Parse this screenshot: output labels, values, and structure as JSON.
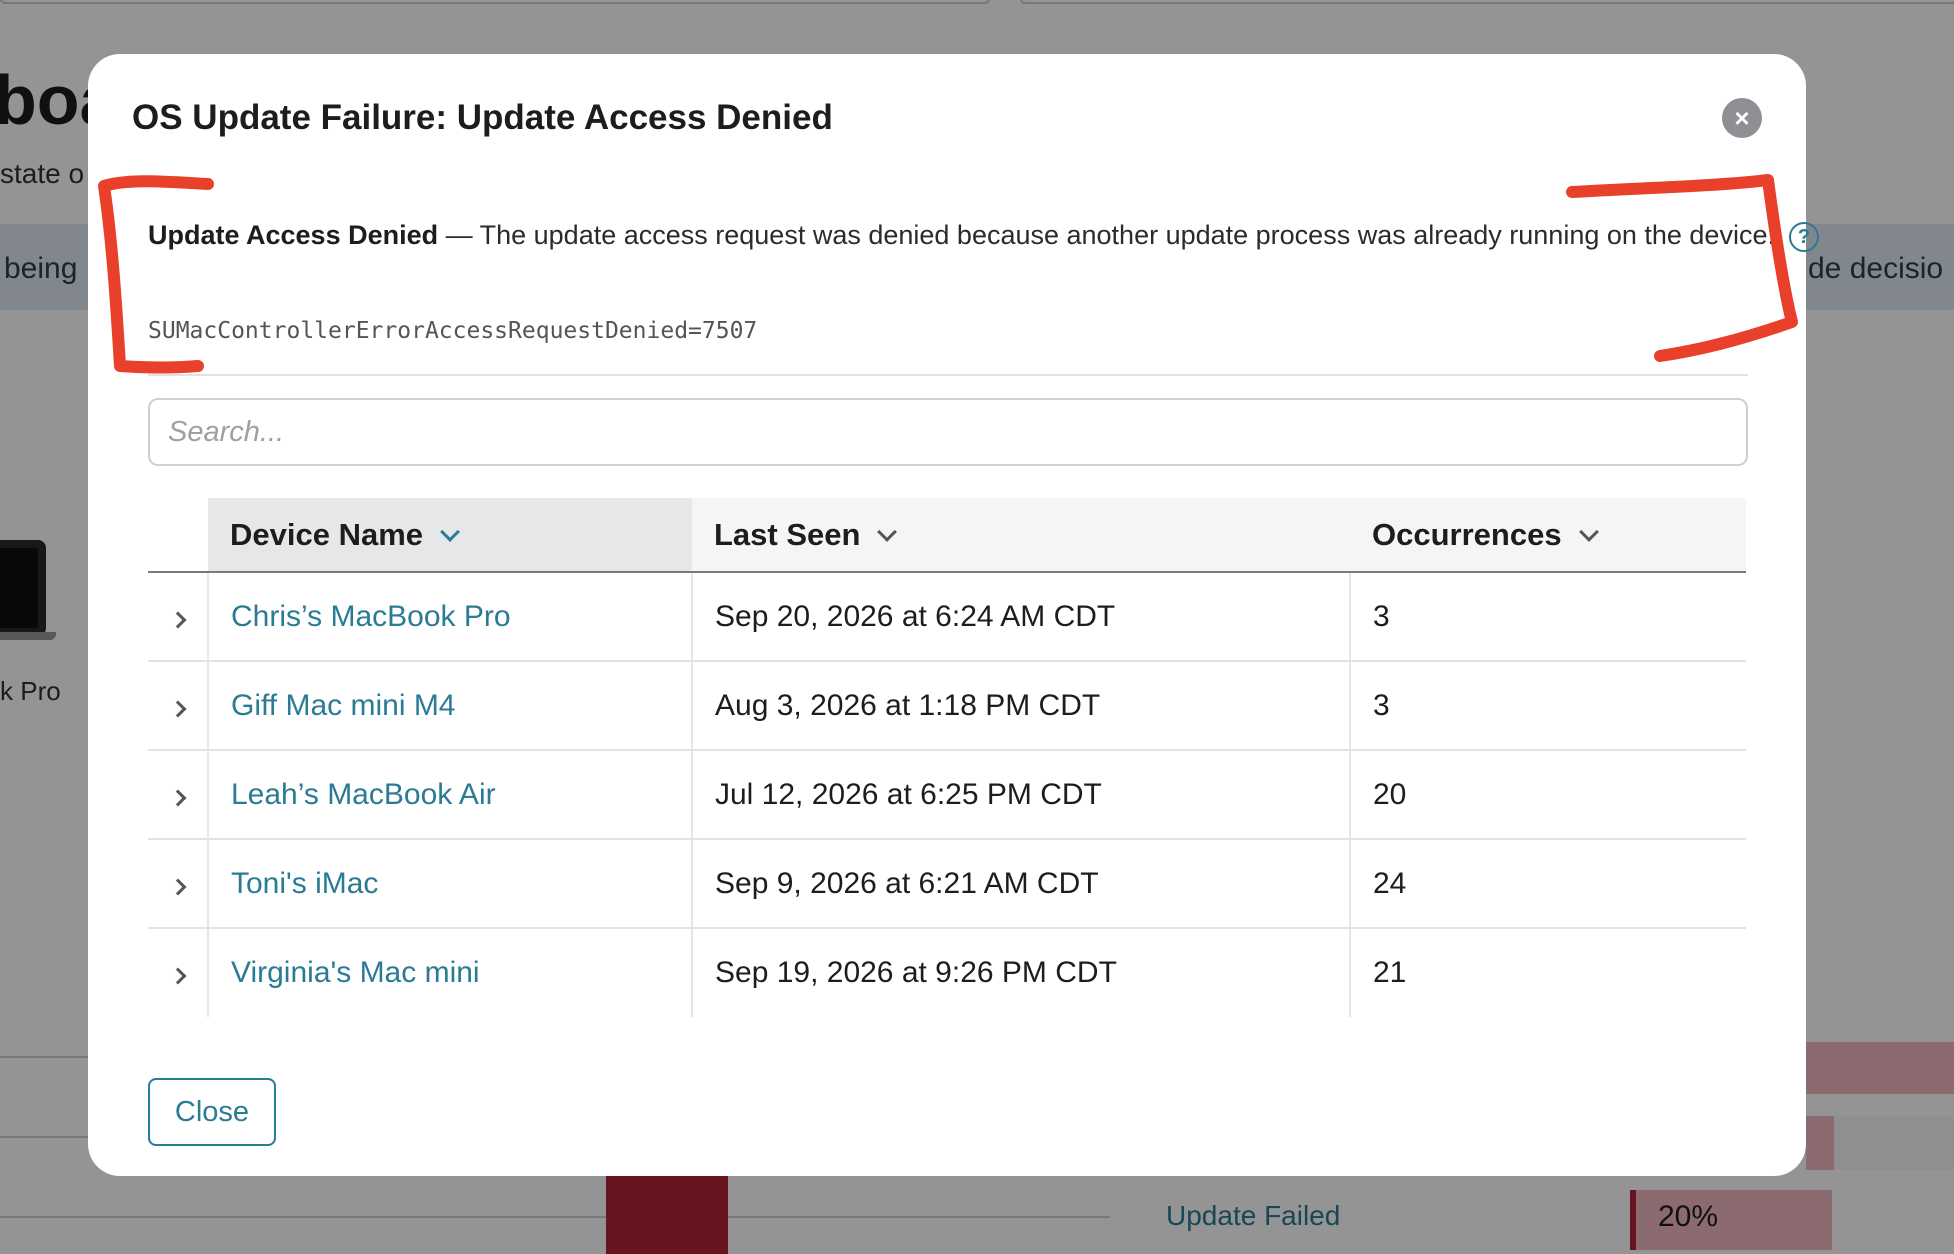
{
  "background": {
    "title_fragment": "boa",
    "subtitle_fragment": "state o",
    "band_left": "being",
    "band_right": "de decisio",
    "device_label": "k Pro",
    "update_failed_label": "Update Failed",
    "update_failed_percent": "20%"
  },
  "modal": {
    "title": "OS Update Failure: Update Access Denied",
    "description_title": "Update Access Denied",
    "description_text": " — The update access request was denied because another update process was already running on the device.",
    "help_icon": "?",
    "error_code": "SUMacControllerErrorAccessRequestDenied=7507",
    "search_placeholder": "Search...",
    "close_label": "Close",
    "close_icon": "×"
  },
  "table": {
    "columns": [
      "Device Name",
      "Last Seen",
      "Occurrences"
    ],
    "rows": [
      {
        "name": "Chris’s MacBook Pro",
        "last_seen": "Sep 20, 2026 at 6:24 AM CDT",
        "occurrences": "3"
      },
      {
        "name": "Giff Mac mini M4",
        "last_seen": "Aug 3, 2026 at 1:18 PM CDT",
        "occurrences": "3"
      },
      {
        "name": "Leah’s MacBook Air",
        "last_seen": "Jul 12, 2026 at 6:25 PM CDT",
        "occurrences": "20"
      },
      {
        "name": "Toni's iMac",
        "last_seen": "Sep 9, 2026 at 6:21 AM CDT",
        "occurrences": "24"
      },
      {
        "name": "Virginia's Mac mini",
        "last_seen": "Sep 19, 2026 at 9:26 PM CDT",
        "occurrences": "21"
      }
    ]
  },
  "colors": {
    "accent": "#2a7b94",
    "annotation": "#e8402a"
  }
}
